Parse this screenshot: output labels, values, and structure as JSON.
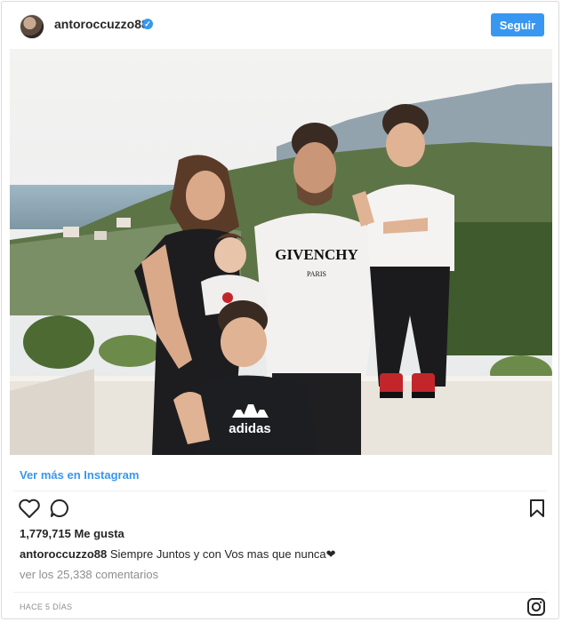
{
  "header": {
    "username": "antoroccuzzo88",
    "verified_icon": "✓",
    "follow_label": "Seguir"
  },
  "post": {
    "shirt_brand": "GIVENCHY",
    "shirt_city": "PARIS",
    "tee_brand": "adidas",
    "view_link": "Ver más en Instagram",
    "likes": "1,779,715 Me gusta",
    "caption_user": "antoroccuzzo88",
    "caption_text": " Siempre Juntos y con Vos mas que nunca❤",
    "comments_link": "ver los 25,338 comentarios",
    "timestamp": "HACE 5 DÍAS"
  },
  "colors": {
    "accent": "#3897f0",
    "text": "#262626",
    "muted": "#8e8e8e"
  },
  "icons": {
    "like": "heart-icon",
    "comment": "comment-icon",
    "save": "bookmark-icon",
    "instagram": "instagram-icon"
  }
}
